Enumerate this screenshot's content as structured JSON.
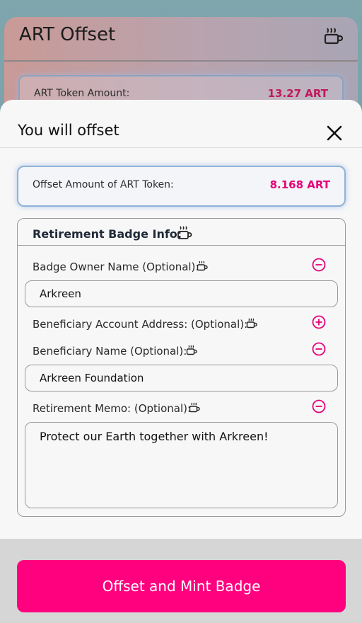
{
  "background": {
    "title": "ART Offset",
    "icon": "coffee-cup-icon",
    "token_label": "ART Token Amount:",
    "token_value": "13.27 ART"
  },
  "sheet": {
    "title": "You will offset",
    "close_icon": "close-icon"
  },
  "offset": {
    "label": "Offset Amount of ART Token:",
    "value": "8.168 ART",
    "accent": "#e6007a"
  },
  "badge": {
    "title": "Retirement Badge Info:",
    "fields": {
      "owner_label": "Badge Owner Name (Optional):",
      "owner_value": "Arkreen",
      "beneficiary_address_label": "Beneficiary Account Address: (Optional):",
      "beneficiary_name_label": "Beneficiary Name (Optional):",
      "beneficiary_name_value": "Arkreen Foundation",
      "memo_label": "Retirement Memo: (Optional):",
      "memo_value": "Protect our Earth together with Arkreen!"
    }
  },
  "footer": {
    "button_label": "Offset and Mint Badge",
    "button_color": "#ff007f"
  }
}
